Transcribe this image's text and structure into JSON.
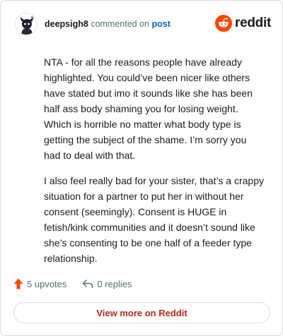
{
  "header": {
    "username": "deepsigh8",
    "action_text": "commented on",
    "post_link": "post",
    "brand_name": "reddit"
  },
  "comment": {
    "paragraphs": [
      "NTA - for all the reasons people have already highlighted. You could’ve been nicer like others have stated but imo it sounds like she has been half ass body shaming you for losing weight. Which is horrible no matter what body type is getting the subject of the shame. I’m sorry you had to deal with that.",
      "I also feel really bad for your sister, that’s a crappy situation for a partner to put her in without her consent (seemingly). Consent is HUGE in fetish/kink communities and it doesn’t sound like she’s consenting to be one half of a feeder type relationship."
    ]
  },
  "footer": {
    "upvotes_label": "5 upvotes",
    "replies_label": "0 replies",
    "view_more_label": "View more on Reddit"
  },
  "colors": {
    "brand_orange": "#ff4500",
    "link_blue": "#0a66c2",
    "view_more_red": "#b3261e",
    "muted": "#576f76"
  },
  "icons": {
    "avatar": "snoo-avatar",
    "brand": "reddit-snoo-icon",
    "upvote": "upvote-arrow-icon",
    "reply": "reply-arrow-icon"
  }
}
